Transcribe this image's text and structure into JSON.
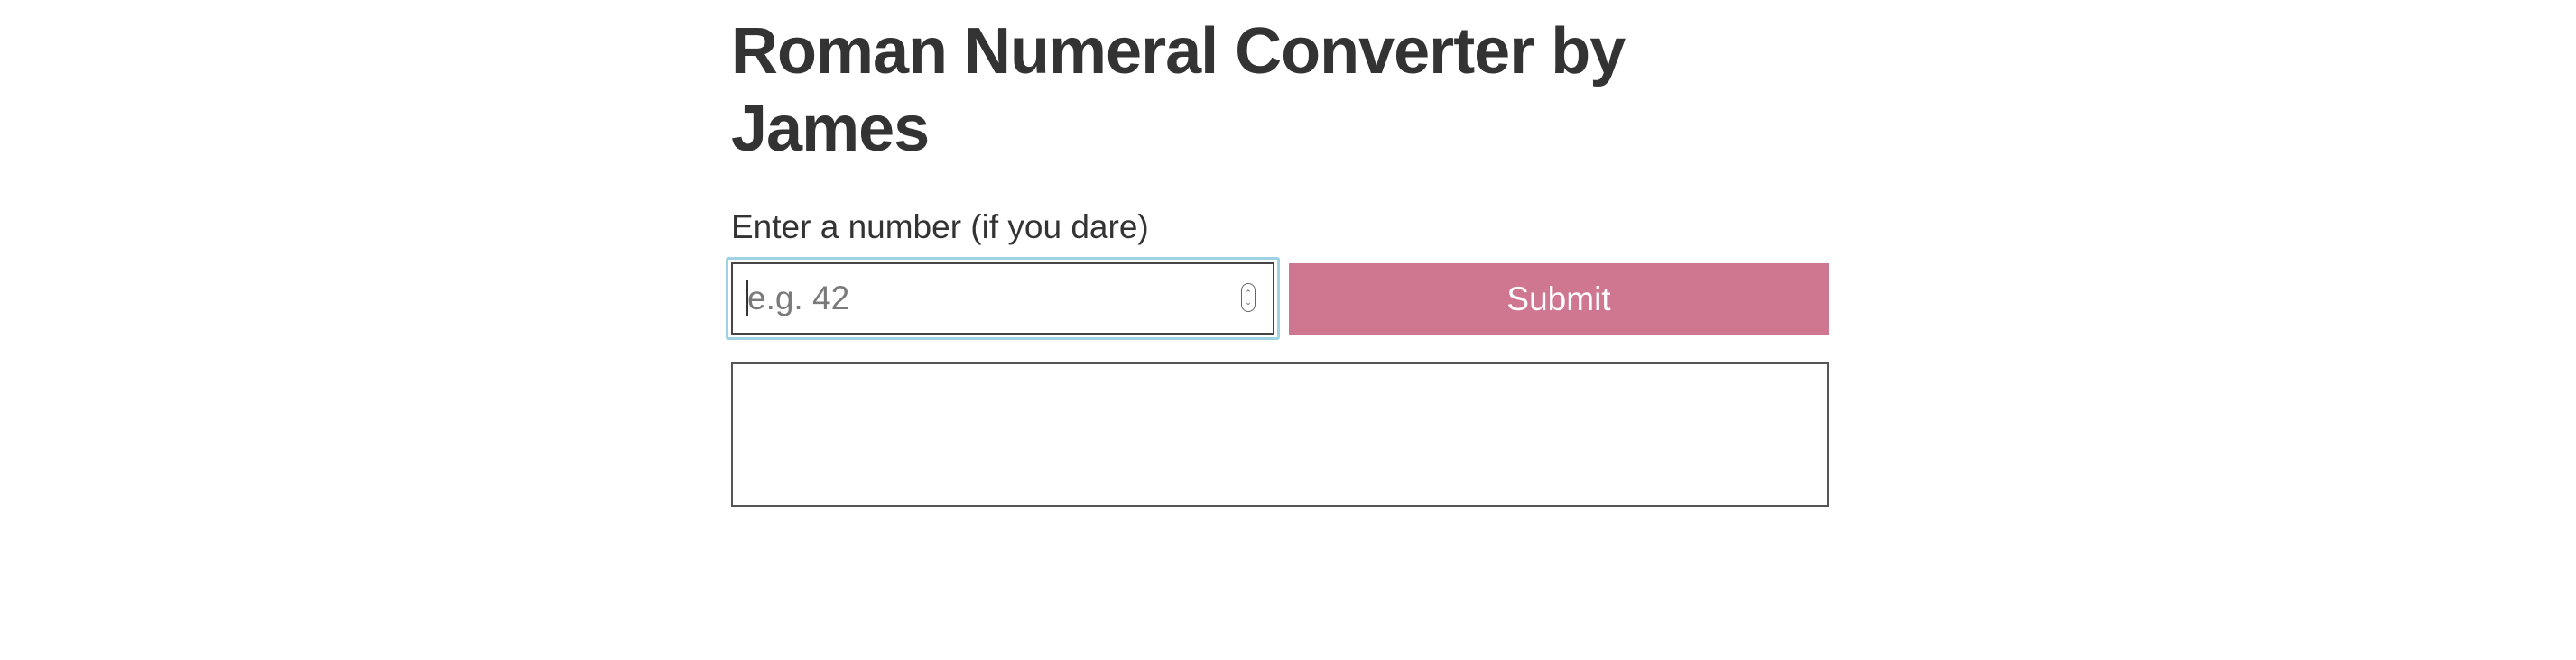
{
  "page": {
    "title": "Roman Numeral Converter by James"
  },
  "form": {
    "label": "Enter a number (if you dare)",
    "input": {
      "value": "",
      "placeholder": "e.g. 42"
    },
    "submit_label": "Submit"
  },
  "output": {
    "text": ""
  },
  "icons": {
    "spinner": "number-spinner-icon"
  },
  "colors": {
    "submit_background": "#cf7690",
    "focus_ring": "#9fd3e3",
    "text": "#333333"
  }
}
